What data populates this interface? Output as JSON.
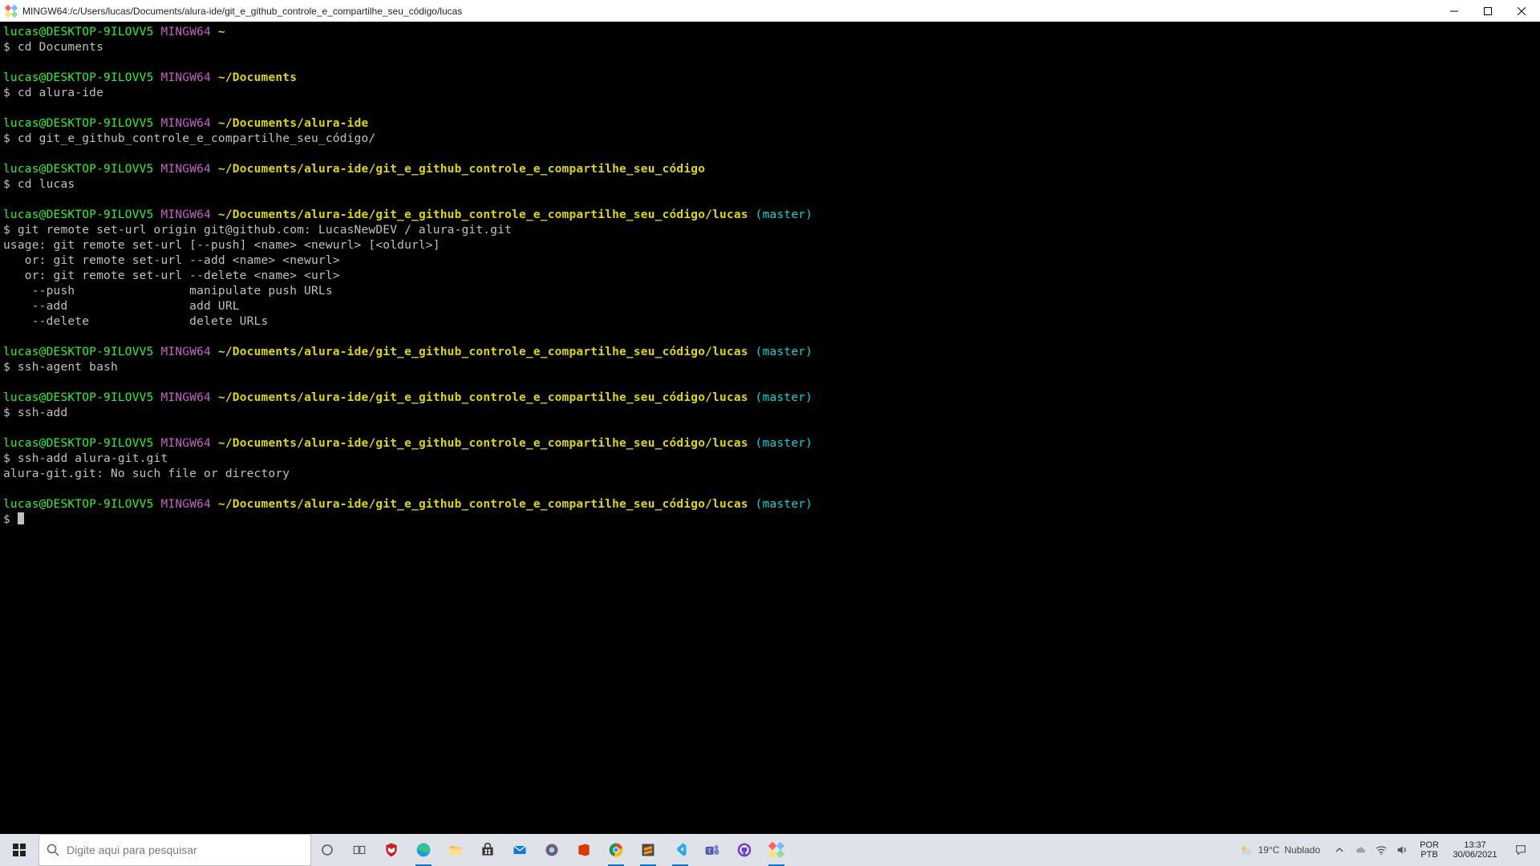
{
  "window": {
    "title": "MINGW64:/c/Users/lucas/Documents/alura-ide/git_e_github_controle_e_compartilhe_seu_código/lucas"
  },
  "colors": {
    "user": "#2bf32b",
    "env": "#c660c6",
    "path": "#ddd800",
    "branch": "#00d7d7"
  },
  "terminal": {
    "user": "lucas@DESKTOP-9ILOVV5",
    "env": "MINGW64",
    "prompt_symbol": "$",
    "blocks": [
      {
        "path_head": "~",
        "path_tail": "",
        "branch": "",
        "command": "cd Documents",
        "output": []
      },
      {
        "path_head": "~",
        "path_tail": "/Documents",
        "branch": "",
        "command": "cd alura-ide",
        "output": []
      },
      {
        "path_head": "~",
        "path_tail": "/Documents/alura-ide",
        "branch": "",
        "command": "cd git_e_github_controle_e_compartilhe_seu_código/",
        "output": []
      },
      {
        "path_head": "~",
        "path_tail": "/Documents/alura-ide/git_e_github_controle_e_compartilhe_seu_código",
        "branch": "",
        "command": "cd lucas",
        "output": []
      },
      {
        "path_head": "~",
        "path_tail": "/Documents/alura-ide/git_e_github_controle_e_compartilhe_seu_código/lucas",
        "branch": "(master)",
        "command": "git remote set-url origin git@github.com: LucasNewDEV / alura-git.git",
        "output": [
          "usage: git remote set-url [--push] <name> <newurl> [<oldurl>]",
          "   or: git remote set-url --add <name> <newurl>",
          "   or: git remote set-url --delete <name> <url>",
          "",
          "    --push                manipulate push URLs",
          "    --add                 add URL",
          "    --delete              delete URLs",
          ""
        ]
      },
      {
        "path_head": "~",
        "path_tail": "/Documents/alura-ide/git_e_github_controle_e_compartilhe_seu_código/lucas",
        "branch": "(master)",
        "command": "ssh-agent bash",
        "output": []
      },
      {
        "path_head": "~",
        "path_tail": "/Documents/alura-ide/git_e_github_controle_e_compartilhe_seu_código/lucas",
        "branch": "(master)",
        "command": "ssh-add",
        "output": []
      },
      {
        "path_head": "~",
        "path_tail": "/Documents/alura-ide/git_e_github_controle_e_compartilhe_seu_código/lucas",
        "branch": "(master)",
        "command": "ssh-add alura-git.git",
        "output": [
          "alura-git.git: No such file or directory"
        ]
      },
      {
        "path_head": "~",
        "path_tail": "/Documents/alura-ide/git_e_github_controle_e_compartilhe_seu_código/lucas",
        "branch": "(master)",
        "command": "",
        "output": [],
        "cursor": true
      }
    ]
  },
  "taskbar": {
    "search_placeholder": "Digite aqui para pesquisar",
    "weather": {
      "temp": "19°C",
      "cond": "Nublado"
    },
    "lang": {
      "top": "POR",
      "bottom": "PTB"
    },
    "clock": {
      "time": "13:37",
      "date": "30/06/2021"
    },
    "apps": [
      {
        "name": "cortana-icon"
      },
      {
        "name": "taskview-icon"
      },
      {
        "name": "mcafee-icon"
      },
      {
        "name": "edge-icon",
        "active": true
      },
      {
        "name": "explorer-icon"
      },
      {
        "name": "store-icon"
      },
      {
        "name": "mail-icon"
      },
      {
        "name": "browser-icon"
      },
      {
        "name": "office-icon"
      },
      {
        "name": "chrome-icon",
        "active": true
      },
      {
        "name": "sublime-icon",
        "active": true
      },
      {
        "name": "vscode-icon",
        "active": true
      },
      {
        "name": "teams-icon"
      },
      {
        "name": "github-icon"
      },
      {
        "name": "gitbash-icon",
        "active": true
      }
    ]
  }
}
